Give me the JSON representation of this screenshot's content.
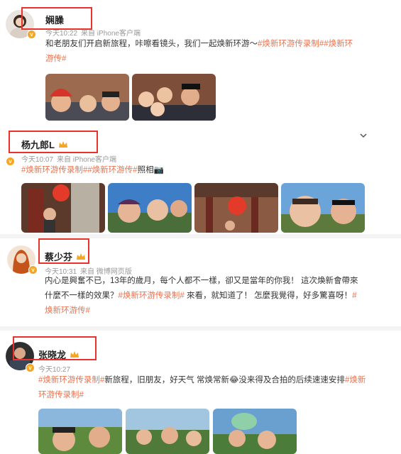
{
  "posts": [
    {
      "name": "娴臊",
      "time": "今天10:22",
      "source": "来自 iPhone客户端",
      "text_lines": [
        [
          {
            "t": "和老朋友们开启新旅程，咔嚓看镜头，我们一起焕新环游～",
            "tag": false
          },
          {
            "t": "#焕新环游传录制##焕新环",
            "tag": true
          }
        ],
        [
          {
            "t": "游传#",
            "tag": true
          }
        ]
      ]
    },
    {
      "name": "杨九郎L",
      "time": "今天10:07",
      "source": "来自 iPhone客户端",
      "text_lines": [
        [
          {
            "t": "#焕新环游传录制##焕新环游传#",
            "tag": true
          },
          {
            "t": "照相📷",
            "tag": false
          }
        ]
      ]
    },
    {
      "name": "蔡少芬",
      "time": "今天10:31",
      "source": "来自 微博网页版",
      "text_lines": [
        [
          {
            "t": "内心是興奮不已，13年的歲月，每个人都不一樣，卻又是當年的你我！ 這次煥新會帶來",
            "tag": false
          }
        ],
        [
          {
            "t": "什麼不一樣的效果？",
            "tag": false
          },
          {
            "t": "#焕新环游传录制#",
            "tag": true
          },
          {
            "t": " 來看，就知道了！ 怎麼我覺得，好多驚喜呀！",
            "tag": false
          },
          {
            "t": "#",
            "tag": true
          }
        ],
        [
          {
            "t": "焕新环游传#",
            "tag": true
          }
        ]
      ]
    },
    {
      "name": "张晓龙",
      "time": "今天10:27",
      "source": "",
      "text_lines": [
        [
          {
            "t": "#焕新环游传录制#",
            "tag": true
          },
          {
            "t": "新旅程，旧朋友，好天气 常焕常新😂没来得及合拍的后续速速安排",
            "tag": false
          },
          {
            "t": "#焕新",
            "tag": true
          }
        ],
        [
          {
            "t": "环游传录制#",
            "tag": true
          }
        ]
      ]
    }
  ],
  "colors": {
    "tag": "#eb7350",
    "highlight_box": "#e8322b",
    "vip": "#f5a623"
  },
  "icons": [
    "crown-icon",
    "chevron-down-icon",
    "vip-badge-icon",
    "camera-emoji"
  ]
}
